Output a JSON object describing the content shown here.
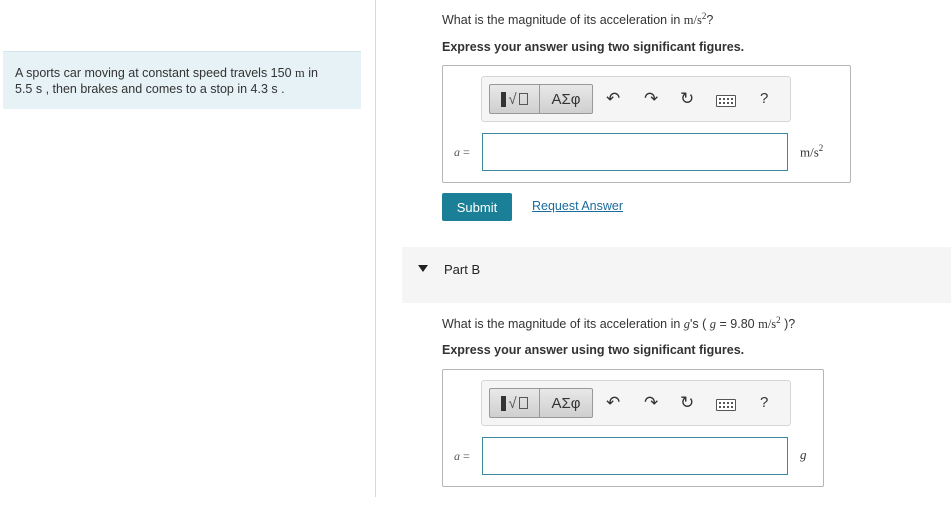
{
  "problem": {
    "prefix": "A sports car moving at constant speed travels 150 ",
    "unit_m": "m",
    "suffix_line1": " in",
    "line2": "5.5 s , then brakes and comes to a stop in 4.3 s ."
  },
  "part_a": {
    "question_prefix": "What is the magnitude of its acceleration in ",
    "question_unit": "m/s",
    "question_exp": "2",
    "question_suffix": "?",
    "instruction": "Express your answer using two significant figures.",
    "var_label": "a",
    "eq": " =",
    "input_value": "",
    "unit": "m/s",
    "unit_exp": "2",
    "submit_label": "Submit",
    "request_label": "Request Answer"
  },
  "part_b": {
    "title": "Part B",
    "question_prefix": "What is the magnitude of its acceleration in ",
    "question_g": "g",
    "question_mid": "'s ( ",
    "question_g2": "g",
    "question_eq": " = 9.80 ",
    "question_unit": "m/s",
    "question_exp": "2",
    "question_suffix": " )?",
    "instruction": "Express your answer using two significant figures.",
    "var_label": "a",
    "eq": " =",
    "input_value": "",
    "unit": "g"
  },
  "toolbar": {
    "greek_label": "ΑΣφ",
    "undo_icon": "↶",
    "redo_icon": "↷",
    "reset_icon": "↻",
    "help_label": "?"
  }
}
